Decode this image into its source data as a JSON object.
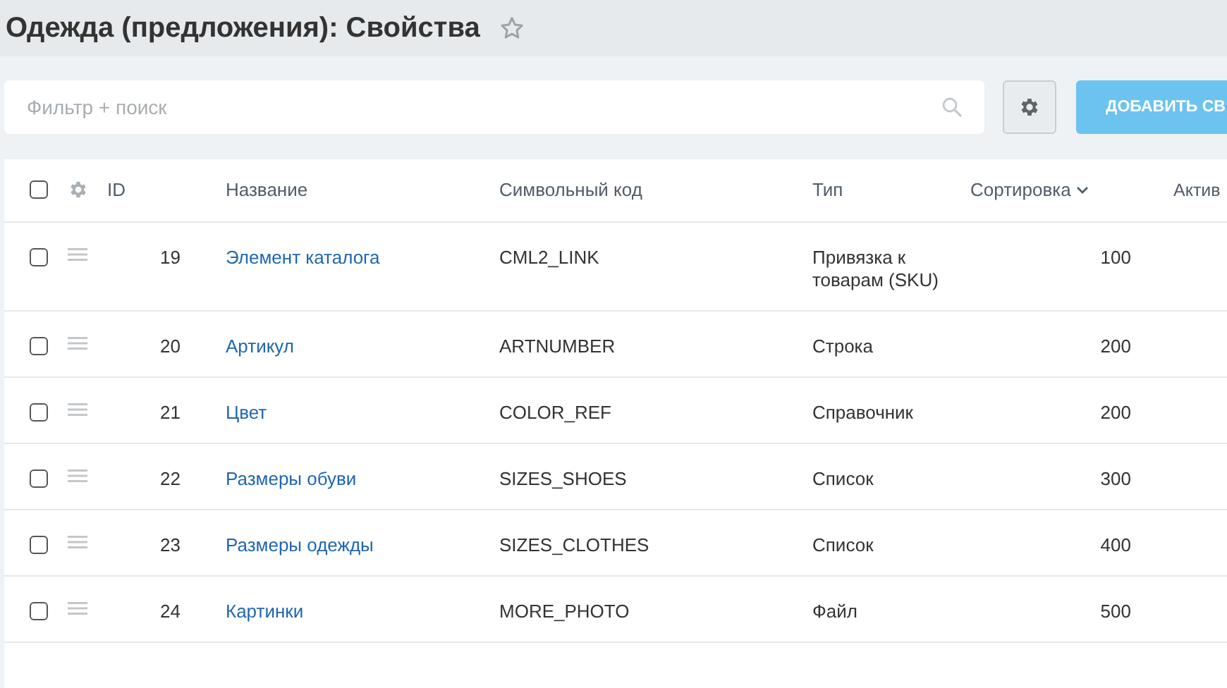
{
  "page": {
    "title": "Одежда (предложения): Свойства",
    "favorite": false
  },
  "toolbar": {
    "search": {
      "placeholder": "Фильтр + поиск"
    },
    "add_button": "ДОБАВИТЬ СВ"
  },
  "table": {
    "select_all_checked": false,
    "columns": [
      {
        "label": "ID",
        "sorted": false
      },
      {
        "label": "Название",
        "sorted": false
      },
      {
        "label": "Символьный код",
        "sorted": false
      },
      {
        "label": "Тип",
        "sorted": false
      },
      {
        "label": "Сортировка",
        "sorted": true
      },
      {
        "label": "Актив",
        "sorted": false
      }
    ],
    "rows": [
      {
        "checked": false,
        "id": "19",
        "name": "Элемент каталога",
        "code": "CML2_LINK",
        "type": "Привязка к товарам (SKU)",
        "sort": "100"
      },
      {
        "checked": false,
        "id": "20",
        "name": "Артикул",
        "code": "ARTNUMBER",
        "type": "Строка",
        "sort": "200"
      },
      {
        "checked": false,
        "id": "21",
        "name": "Цвет",
        "code": "COLOR_REF",
        "type": "Справочник",
        "sort": "200"
      },
      {
        "checked": false,
        "id": "22",
        "name": "Размеры обуви",
        "code": "SIZES_SHOES",
        "type": "Список",
        "sort": "300"
      },
      {
        "checked": false,
        "id": "23",
        "name": "Размеры одежды",
        "code": "SIZES_CLOTHES",
        "type": "Список",
        "sort": "400"
      },
      {
        "checked": false,
        "id": "24",
        "name": "Картинки",
        "code": "MORE_PHOTO",
        "type": "Файл",
        "sort": "500"
      }
    ]
  }
}
